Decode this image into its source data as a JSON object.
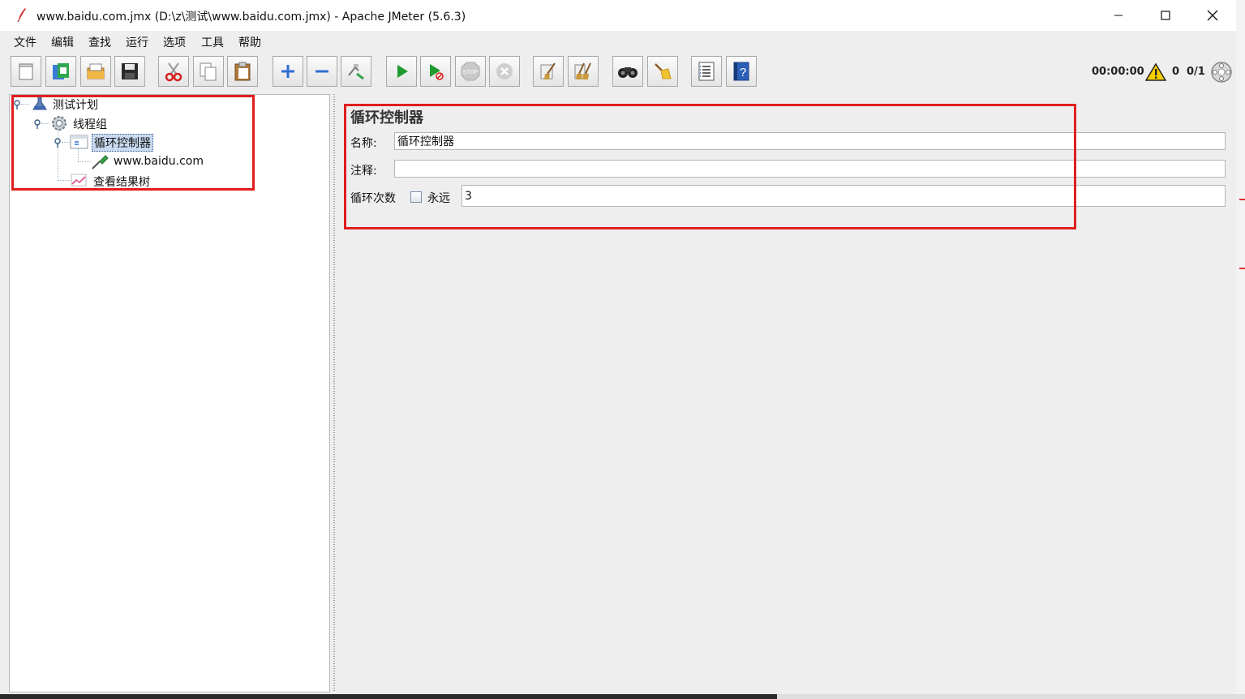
{
  "window": {
    "title": "www.baidu.com.jmx (D:\\z\\测试\\www.baidu.com.jmx) - Apache JMeter (5.6.3)"
  },
  "menu": [
    "文件",
    "编辑",
    "查找",
    "运行",
    "选项",
    "工具",
    "帮助"
  ],
  "toolbar": {
    "buttons": [
      "new-icon",
      "templates-icon",
      "open-icon",
      "save-icon",
      "cut-icon",
      "copy-icon",
      "paste-icon",
      "expand-icon",
      "collapse-icon",
      "toggle-icon",
      "start-icon",
      "start-no-pause-icon",
      "stop-icon",
      "shutdown-icon",
      "clear-icon",
      "clear-all-icon",
      "search-icon",
      "reset-search-icon",
      "function-helper-icon",
      "help-icon"
    ],
    "timer": "00:00:00",
    "warning_count": "0",
    "thread_count": "0/1"
  },
  "tree": {
    "nodes": [
      {
        "label": "测试计划",
        "icon": "test-plan-icon"
      },
      {
        "label": "线程组",
        "icon": "thread-group-icon"
      },
      {
        "label": "循环控制器",
        "icon": "loop-controller-icon",
        "selected": true
      },
      {
        "label": "www.baidu.com",
        "icon": "http-sampler-icon"
      },
      {
        "label": "查看结果树",
        "icon": "results-tree-icon"
      }
    ]
  },
  "panel": {
    "title": "循环控制器",
    "name_label": "名称:",
    "name_value": "循环控制器",
    "comment_label": "注释:",
    "comment_value": "",
    "loop_label": "循环次数",
    "forever_label": "永远",
    "forever_checked": false,
    "loop_value": "3"
  },
  "colors": {
    "highlight_box": "#e01e1e",
    "selection": "#c9daf0"
  }
}
